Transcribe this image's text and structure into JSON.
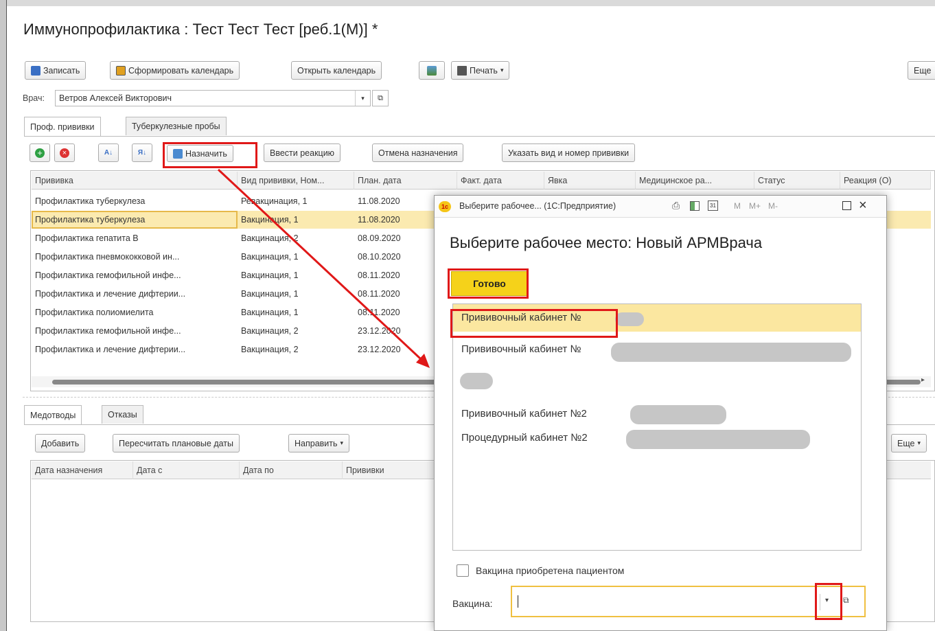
{
  "window": {
    "title": "Иммунопрофилактика : Тест Тест Тест [реб.1(М)] *"
  },
  "toolbar": {
    "save": "Записать",
    "form_calendar": "Сформировать календарь",
    "open_calendar": "Открыть календарь",
    "print": "Печать",
    "more": "Еще"
  },
  "doctor": {
    "label": "Врач:",
    "value": "Ветров Алексей Викторович"
  },
  "tabs": [
    "Проф. прививки",
    "Туберкулезные пробы"
  ],
  "grid_toolbar": {
    "assign": "Назначить",
    "enter_reaction": "Ввести реакцию",
    "cancel_assign": "Отмена назначения",
    "specify_type": "Указать вид и номер прививки"
  },
  "grid": {
    "columns": [
      "Прививка",
      "Вид прививки, Ном...",
      "План. дата",
      "Факт. дата",
      "Явка",
      "Медицинское ра...",
      "Статус",
      "Реакция (О)"
    ],
    "rows": [
      [
        "Профилактика туберкулеза",
        "Ревакцинация, 1",
        "11.08.2020"
      ],
      [
        "Профилактика туберкулеза",
        "Вакцинация, 1",
        "11.08.2020"
      ],
      [
        "Профилактика гепатита В",
        "Вакцинация, 2",
        "08.09.2020"
      ],
      [
        "Профилактика пневмококковой ин...",
        "Вакцинация, 1",
        "08.10.2020"
      ],
      [
        "Профилактика гемофильной инфе...",
        "Вакцинация, 1",
        "08.11.2020"
      ],
      [
        "Профилактика и лечение дифтерии...",
        "Вакцинация, 1",
        "08.11.2020"
      ],
      [
        "Профилактика полиомиелита",
        "Вакцинация, 1",
        "08.11.2020"
      ],
      [
        "Профилактика гемофильной инфе...",
        "Вакцинация, 2",
        "23.12.2020"
      ],
      [
        "Профилактика и лечение дифтерии...",
        "Вакцинация, 2",
        "23.12.2020"
      ]
    ]
  },
  "bottom_tabs": [
    "Медотводы",
    "Отказы"
  ],
  "bottom_toolbar": {
    "add": "Добавить",
    "recalc": "Пересчитать плановые даты",
    "direct": "Направить",
    "more": "Еще"
  },
  "bottom_grid": {
    "columns": [
      "Дата назначения",
      "Дата с",
      "Дата по",
      "Прививки"
    ]
  },
  "dialog": {
    "title_bar": "Выберите рабочее... (1С:Предприятие)",
    "title_m": "M",
    "title_mplus": "M+",
    "title_mminus": "M-",
    "heading": "Выберите рабочее место: Новый АРМВрача",
    "ready_button": "Готово",
    "list": [
      "Прививочный кабинет №",
      "Прививочный кабинет №",
      "Прививочный кабинет №2",
      "Процедурный кабинет №2"
    ],
    "checkbox_label": "Вакцина приобретена пациентом",
    "vaccine_label": "Вакцина:",
    "vaccine_value": ""
  },
  "colors": {
    "highlight": "#e01818",
    "selection": "#fbeab0",
    "ready_button": "#f5d21a",
    "focus": "#f0c040"
  }
}
